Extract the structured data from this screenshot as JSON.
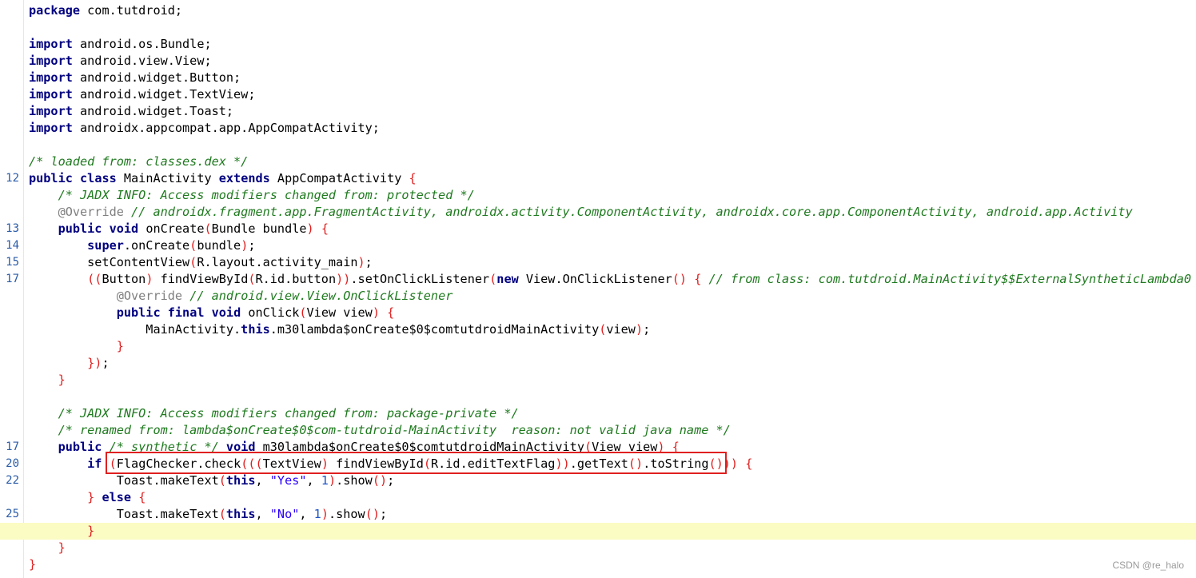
{
  "editor": {
    "lines": [
      {
        "ln": "",
        "tokens": [
          {
            "t": "package",
            "c": "kw"
          },
          {
            "t": " com.tutdroid;"
          }
        ]
      },
      {
        "ln": "",
        "tokens": []
      },
      {
        "ln": "",
        "tokens": [
          {
            "t": "import",
            "c": "kw"
          },
          {
            "t": " android.os.Bundle;"
          }
        ]
      },
      {
        "ln": "",
        "tokens": [
          {
            "t": "import",
            "c": "kw"
          },
          {
            "t": " android.view.View;"
          }
        ]
      },
      {
        "ln": "",
        "tokens": [
          {
            "t": "import",
            "c": "kw"
          },
          {
            "t": " android.widget.Button;"
          }
        ]
      },
      {
        "ln": "",
        "tokens": [
          {
            "t": "import",
            "c": "kw"
          },
          {
            "t": " android.widget.TextView;"
          }
        ]
      },
      {
        "ln": "",
        "tokens": [
          {
            "t": "import",
            "c": "kw"
          },
          {
            "t": " android.widget.Toast;"
          }
        ]
      },
      {
        "ln": "",
        "tokens": [
          {
            "t": "import",
            "c": "kw"
          },
          {
            "t": " androidx.appcompat.app.AppCompatActivity;"
          }
        ]
      },
      {
        "ln": "",
        "tokens": []
      },
      {
        "ln": "",
        "tokens": [
          {
            "t": "/* loaded from: classes.dex */",
            "c": "cm"
          }
        ]
      },
      {
        "ln": "12",
        "tokens": [
          {
            "t": "public",
            "c": "kw"
          },
          {
            "t": " "
          },
          {
            "t": "class",
            "c": "kw"
          },
          {
            "t": " MainActivity "
          },
          {
            "t": "extends",
            "c": "kw"
          },
          {
            "t": " AppCompatActivity "
          },
          {
            "t": "{",
            "c": "br"
          }
        ]
      },
      {
        "ln": "",
        "tokens": [
          {
            "t": "    "
          },
          {
            "t": "/* JADX INFO: Access modifiers changed from: protected */",
            "c": "cm"
          }
        ]
      },
      {
        "ln": "",
        "tokens": [
          {
            "t": "    "
          },
          {
            "t": "@Override",
            "c": "an"
          },
          {
            "t": " "
          },
          {
            "t": "// androidx.fragment.app.FragmentActivity, androidx.activity.ComponentActivity, androidx.core.app.ComponentActivity, android.app.Activity",
            "c": "cm"
          }
        ]
      },
      {
        "ln": "13",
        "tokens": [
          {
            "t": "    "
          },
          {
            "t": "public",
            "c": "kw"
          },
          {
            "t": " "
          },
          {
            "t": "void",
            "c": "kw"
          },
          {
            "t": " onCreate"
          },
          {
            "t": "(",
            "c": "br"
          },
          {
            "t": "Bundle bundle"
          },
          {
            "t": ")",
            "c": "br"
          },
          {
            "t": " "
          },
          {
            "t": "{",
            "c": "br"
          }
        ]
      },
      {
        "ln": "14",
        "tokens": [
          {
            "t": "        "
          },
          {
            "t": "super",
            "c": "kw"
          },
          {
            "t": ".onCreate"
          },
          {
            "t": "(",
            "c": "br"
          },
          {
            "t": "bundle"
          },
          {
            "t": ")",
            "c": "br"
          },
          {
            "t": ";"
          }
        ]
      },
      {
        "ln": "15",
        "tokens": [
          {
            "t": "        setContentView"
          },
          {
            "t": "(",
            "c": "br"
          },
          {
            "t": "R.layout.activity_main"
          },
          {
            "t": ")",
            "c": "br"
          },
          {
            "t": ";"
          }
        ]
      },
      {
        "ln": "17",
        "tokens": [
          {
            "t": "        "
          },
          {
            "t": "((",
            "c": "br"
          },
          {
            "t": "Button"
          },
          {
            "t": ")",
            "c": "br"
          },
          {
            "t": " findViewById"
          },
          {
            "t": "(",
            "c": "br"
          },
          {
            "t": "R.id.button"
          },
          {
            "t": "))",
            "c": "br"
          },
          {
            "t": ".setOnClickListener"
          },
          {
            "t": "(",
            "c": "br"
          },
          {
            "t": "new",
            "c": "kw"
          },
          {
            "t": " View.OnClickListener"
          },
          {
            "t": "()",
            "c": "br"
          },
          {
            "t": " "
          },
          {
            "t": "{",
            "c": "br"
          },
          {
            "t": " "
          },
          {
            "t": "// from class: com.tutdroid.MainActivity$$ExternalSyntheticLambda0",
            "c": "cm"
          }
        ]
      },
      {
        "ln": "",
        "tokens": [
          {
            "t": "            "
          },
          {
            "t": "@Override",
            "c": "an"
          },
          {
            "t": " "
          },
          {
            "t": "// android.view.View.OnClickListener",
            "c": "cm"
          }
        ]
      },
      {
        "ln": "",
        "tokens": [
          {
            "t": "            "
          },
          {
            "t": "public",
            "c": "kw"
          },
          {
            "t": " "
          },
          {
            "t": "final",
            "c": "kw"
          },
          {
            "t": " "
          },
          {
            "t": "void",
            "c": "kw"
          },
          {
            "t": " onClick"
          },
          {
            "t": "(",
            "c": "br"
          },
          {
            "t": "View view"
          },
          {
            "t": ")",
            "c": "br"
          },
          {
            "t": " "
          },
          {
            "t": "{",
            "c": "br"
          }
        ]
      },
      {
        "ln": "",
        "tokens": [
          {
            "t": "                MainActivity."
          },
          {
            "t": "this",
            "c": "kw"
          },
          {
            "t": ".m30lambda$onCreate$0$comtutdroidMainActivity"
          },
          {
            "t": "(",
            "c": "br"
          },
          {
            "t": "view"
          },
          {
            "t": ")",
            "c": "br"
          },
          {
            "t": ";"
          }
        ]
      },
      {
        "ln": "",
        "tokens": [
          {
            "t": "            "
          },
          {
            "t": "}",
            "c": "br"
          }
        ]
      },
      {
        "ln": "",
        "tokens": [
          {
            "t": "        "
          },
          {
            "t": "})",
            "c": "br"
          },
          {
            "t": ";"
          }
        ]
      },
      {
        "ln": "",
        "tokens": [
          {
            "t": "    "
          },
          {
            "t": "}",
            "c": "br"
          }
        ]
      },
      {
        "ln": "",
        "tokens": []
      },
      {
        "ln": "",
        "tokens": [
          {
            "t": "    "
          },
          {
            "t": "/* JADX INFO: Access modifiers changed from: package-private */",
            "c": "cm"
          }
        ]
      },
      {
        "ln": "",
        "tokens": [
          {
            "t": "    "
          },
          {
            "t": "/* renamed from: lambda$onCreate$0$com-tutdroid-MainActivity  reason: not valid java name */",
            "c": "cm"
          }
        ]
      },
      {
        "ln": "17",
        "tokens": [
          {
            "t": "    "
          },
          {
            "t": "public",
            "c": "kw"
          },
          {
            "t": " "
          },
          {
            "t": "/* synthetic */",
            "c": "cm"
          },
          {
            "t": " "
          },
          {
            "t": "void",
            "c": "kw"
          },
          {
            "t": " m30lambda$onCreate$0$comtutdroidMainActivity"
          },
          {
            "t": "(",
            "c": "br"
          },
          {
            "t": "View view"
          },
          {
            "t": ")",
            "c": "br"
          },
          {
            "t": " "
          },
          {
            "t": "{",
            "c": "br"
          }
        ]
      },
      {
        "ln": "20",
        "tokens": [
          {
            "t": "        "
          },
          {
            "t": "if",
            "c": "kw"
          },
          {
            "t": " "
          },
          {
            "t": "(",
            "c": "br"
          },
          {
            "t": "FlagChecker.check"
          },
          {
            "t": "(((",
            "c": "br"
          },
          {
            "t": "TextView"
          },
          {
            "t": ")",
            "c": "br"
          },
          {
            "t": " findViewById"
          },
          {
            "t": "(",
            "c": "br"
          },
          {
            "t": "R.id.editTextFlag"
          },
          {
            "t": "))",
            "c": "br"
          },
          {
            "t": ".getText"
          },
          {
            "t": "()",
            "c": "br"
          },
          {
            "t": ".toString"
          },
          {
            "t": "()))",
            "c": "br"
          },
          {
            "t": " "
          },
          {
            "t": "{",
            "c": "br"
          }
        ]
      },
      {
        "ln": "22",
        "tokens": [
          {
            "t": "            Toast.makeText"
          },
          {
            "t": "(",
            "c": "br"
          },
          {
            "t": "this",
            "c": "kw"
          },
          {
            "t": ", "
          },
          {
            "t": "\"Yes\"",
            "c": "st"
          },
          {
            "t": ", "
          },
          {
            "t": "1",
            "c": "nm"
          },
          {
            "t": ")",
            "c": "br"
          },
          {
            "t": ".show"
          },
          {
            "t": "()",
            "c": "br"
          },
          {
            "t": ";"
          }
        ]
      },
      {
        "ln": "",
        "tokens": [
          {
            "t": "        "
          },
          {
            "t": "}",
            "c": "br"
          },
          {
            "t": " "
          },
          {
            "t": "else",
            "c": "kw"
          },
          {
            "t": " "
          },
          {
            "t": "{",
            "c": "br"
          }
        ]
      },
      {
        "ln": "25",
        "tokens": [
          {
            "t": "            Toast.makeText"
          },
          {
            "t": "(",
            "c": "br"
          },
          {
            "t": "this",
            "c": "kw"
          },
          {
            "t": ", "
          },
          {
            "t": "\"No\"",
            "c": "st"
          },
          {
            "t": ", "
          },
          {
            "t": "1",
            "c": "nm"
          },
          {
            "t": ")",
            "c": "br"
          },
          {
            "t": ".show"
          },
          {
            "t": "()",
            "c": "br"
          },
          {
            "t": ";"
          }
        ]
      },
      {
        "ln": "",
        "current": true,
        "tokens": [
          {
            "t": "        "
          },
          {
            "t": "}",
            "c": "br"
          }
        ]
      },
      {
        "ln": "",
        "tokens": [
          {
            "t": "    "
          },
          {
            "t": "}",
            "c": "br"
          }
        ]
      },
      {
        "ln": "",
        "tokens": [
          {
            "t": "}",
            "c": "br"
          }
        ]
      }
    ]
  },
  "watermark": "CSDN @re_halo"
}
